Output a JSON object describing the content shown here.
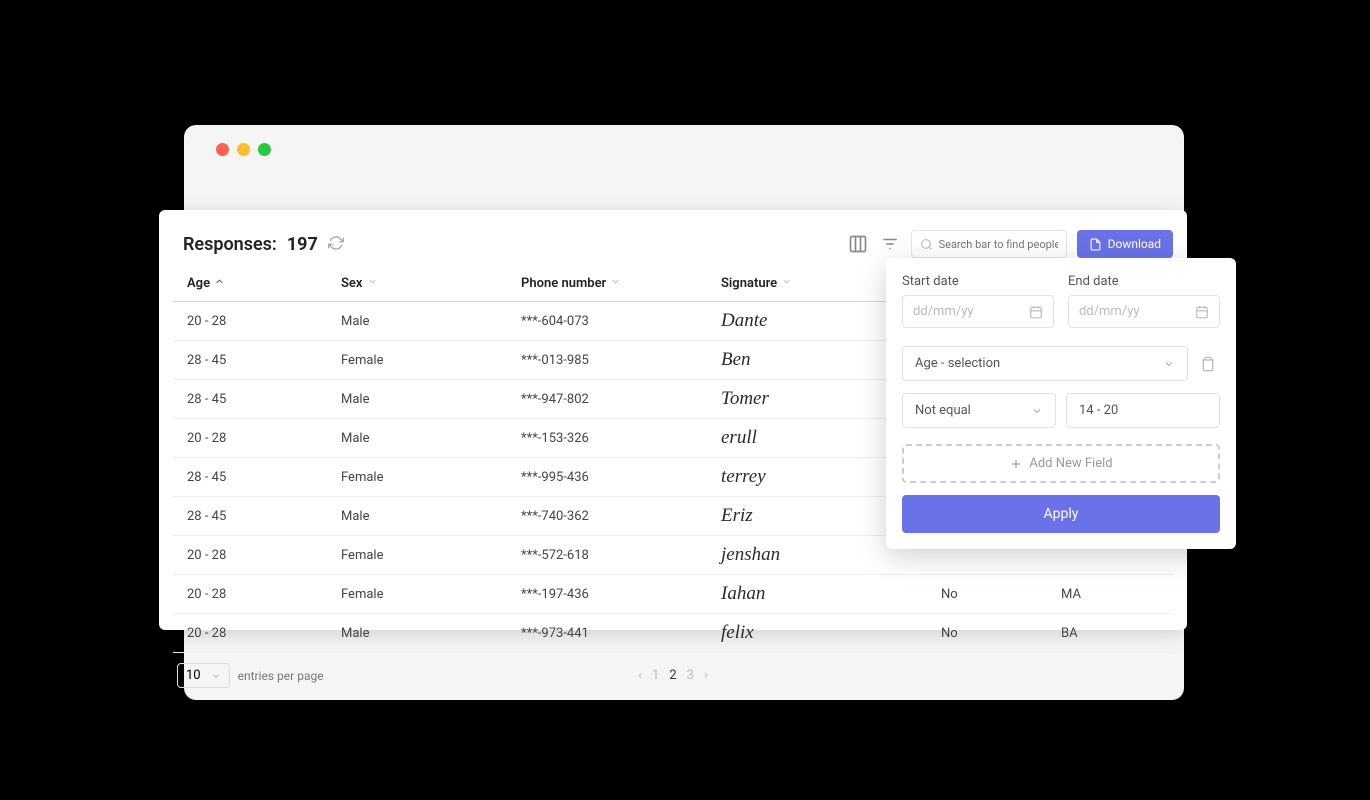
{
  "header": {
    "title_prefix": "Responses:",
    "count": "197",
    "search_placeholder": "Search bar to find people",
    "download_label": "Download"
  },
  "columns": [
    "Age",
    "Sex",
    "Phone number",
    "Signature",
    "",
    ""
  ],
  "rows": [
    {
      "age": "20 - 28",
      "sex": "Male",
      "phone": "***-604-073",
      "sig": "Dante",
      "c5": "",
      "c6": ""
    },
    {
      "age": "28 - 45",
      "sex": "Female",
      "phone": "***-013-985",
      "sig": "Ben",
      "c5": "",
      "c6": ""
    },
    {
      "age": "28 - 45",
      "sex": "Male",
      "phone": "***-947-802",
      "sig": "Tomer",
      "c5": "",
      "c6": ""
    },
    {
      "age": "20 - 28",
      "sex": "Male",
      "phone": "***-153-326",
      "sig": "erull",
      "c5": "",
      "c6": ""
    },
    {
      "age": "28 - 45",
      "sex": "Female",
      "phone": "***-995-436",
      "sig": "terrey",
      "c5": "",
      "c6": ""
    },
    {
      "age": "28 - 45",
      "sex": "Male",
      "phone": "***-740-362",
      "sig": "Eriz",
      "c5": "",
      "c6": ""
    },
    {
      "age": "20 - 28",
      "sex": "Female",
      "phone": "***-572-618",
      "sig": "jenshan",
      "c5": "",
      "c6": ""
    },
    {
      "age": "20 - 28",
      "sex": "Female",
      "phone": "***-197-436",
      "sig": "Iahan",
      "c5": "No",
      "c6": "MA"
    },
    {
      "age": "20 - 28",
      "sex": "Male",
      "phone": "***-973-441",
      "sig": "felix",
      "c5": "No",
      "c6": "BA"
    }
  ],
  "pagination": {
    "per_page": "10",
    "per_page_label": "entries per page",
    "pages": [
      "1",
      "2",
      "3"
    ],
    "current": "2"
  },
  "filter": {
    "start_label": "Start date",
    "end_label": "End date",
    "date_placeholder": "dd/mm/yy",
    "field_select": "Age - selection",
    "condition": "Not equal",
    "value": "14 - 20",
    "add_field": "Add New Field",
    "apply": "Apply"
  }
}
